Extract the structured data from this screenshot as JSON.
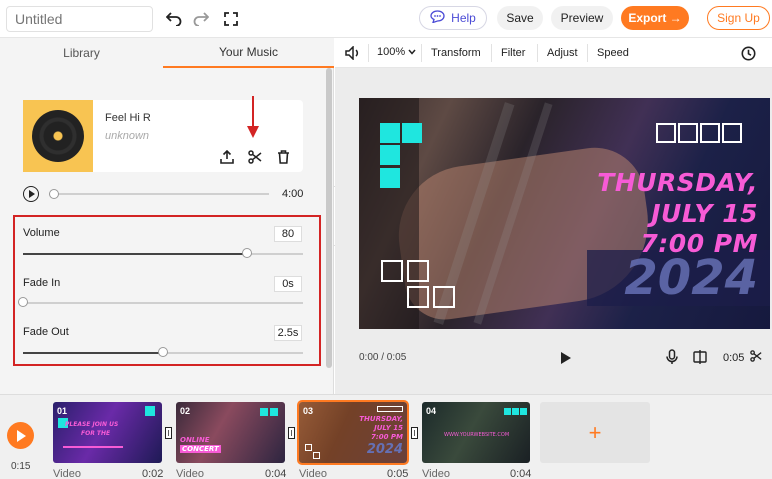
{
  "topbar": {
    "project_title_placeholder": "Untitled",
    "help_label": "Help",
    "save_label": "Save",
    "preview_label": "Preview",
    "export_label": "Export →",
    "signup_label": "Sign Up"
  },
  "panel": {
    "tabs": [
      {
        "label": "Library",
        "active": false
      },
      {
        "label": "Your Music",
        "active": true
      }
    ],
    "track": {
      "name": "Feel Hi R",
      "artist": "unknown",
      "duration": "4:00",
      "progress": 0
    },
    "controls": [
      {
        "label": "Volume",
        "value": "80",
        "level": 0.8
      },
      {
        "label": "Fade In",
        "value": "0s",
        "level": 0
      },
      {
        "label": "Fade Out",
        "value": "2.5s",
        "level": 0.5
      }
    ]
  },
  "toolbar": {
    "zoom": "100%",
    "items": [
      "Transform",
      "Filter",
      "Adjust",
      "Speed"
    ]
  },
  "preview": {
    "lines": [
      "THURSDAY,",
      "JULY 15",
      "7:00 PM"
    ],
    "year": "2024",
    "current_time": "0:00 / 0:05",
    "clip_duration": "0:05"
  },
  "timeline": {
    "current_time": "0:15",
    "clips": [
      {
        "num": "01",
        "label": "Video",
        "duration": "0:02",
        "caption_a": "PLEASE JOIN US",
        "caption_b": "FOR THE"
      },
      {
        "num": "02",
        "label": "Video",
        "duration": "0:04",
        "caption_a": "ONLINE",
        "caption_b": "CONCERT"
      },
      {
        "num": "03",
        "label": "Video",
        "duration": "0:05",
        "caption_a": "THURSDAY,",
        "caption_b": "JULY 15",
        "caption_c": "7:00 PM",
        "caption_d": "2024"
      },
      {
        "num": "04",
        "label": "Video",
        "duration": "0:04",
        "caption_a": "WWW.YOURWEBSITE.COM"
      }
    ]
  },
  "colors": {
    "accent": "#ff7a21",
    "highlight_box": "#d32424",
    "title_pink": "#f75bd6",
    "tile_cyan": "#1fe6df"
  }
}
